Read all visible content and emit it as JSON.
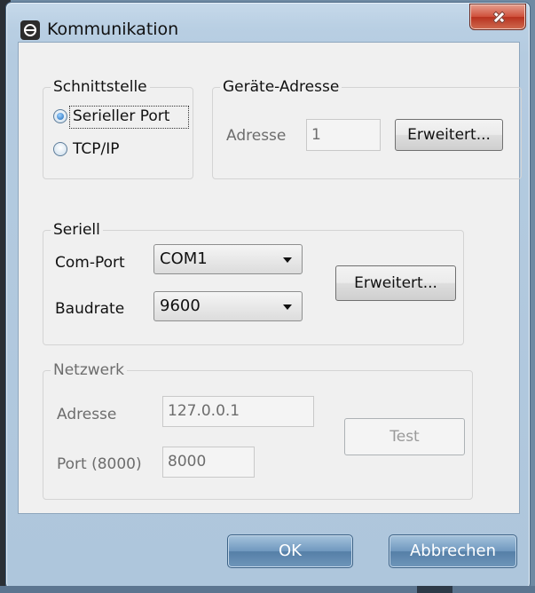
{
  "window": {
    "title": "Kommunikation"
  },
  "interface_group": {
    "legend": "Schnittstelle",
    "options": [
      {
        "label": "Serieller Port",
        "selected": true
      },
      {
        "label": "TCP/IP",
        "selected": false
      }
    ]
  },
  "device_address_group": {
    "legend": "Geräte-Adresse",
    "address_label": "Adresse",
    "address_value": "1",
    "advanced_button": "Erweitert..."
  },
  "serial_group": {
    "legend": "Seriell",
    "com_port_label": "Com-Port",
    "com_port_value": "COM1",
    "baudrate_label": "Baudrate",
    "baudrate_value": "9600",
    "advanced_button": "Erweitert..."
  },
  "network_group": {
    "legend": "Netzwerk",
    "address_label": "Adresse",
    "address_value": "127.0.0.1",
    "port_label": "Port (8000)",
    "port_value": "8000",
    "test_button": "Test"
  },
  "footer": {
    "ok_button": "OK",
    "cancel_button": "Abbrechen"
  },
  "colors": {
    "titlebar": "#b9cfe3",
    "close_button": "#cf4f3a",
    "footer_button": "#6f98bf"
  }
}
